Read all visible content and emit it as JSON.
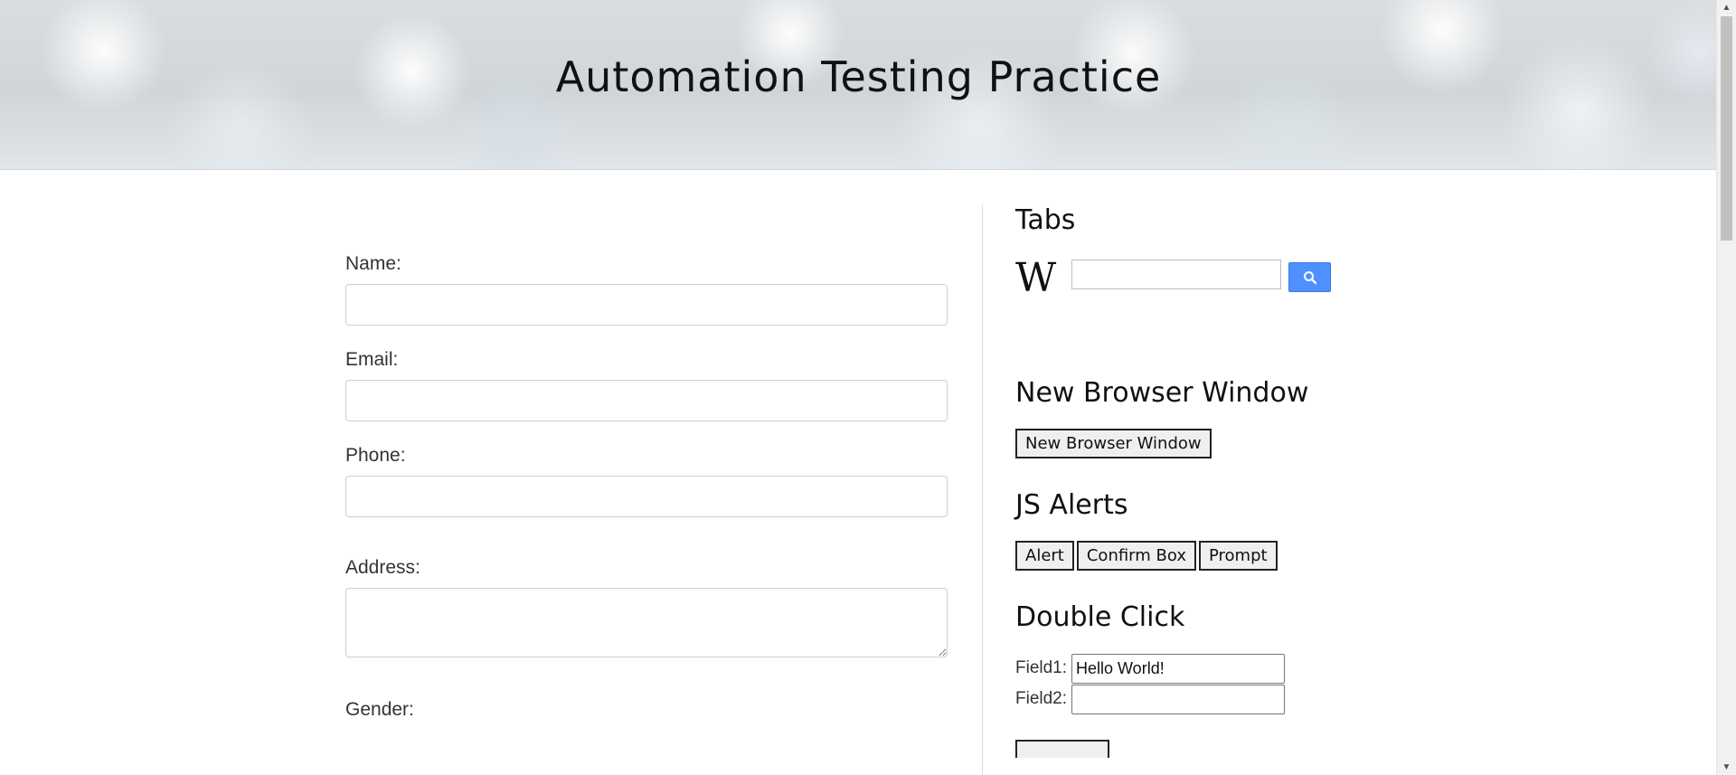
{
  "header": {
    "title": "Automation Testing Practice"
  },
  "form": {
    "name_label": "Name:",
    "email_label": "Email:",
    "phone_label": "Phone:",
    "address_label": "Address:",
    "gender_label": "Gender:",
    "name_value": "",
    "email_value": "",
    "phone_value": "",
    "address_value": ""
  },
  "tabs": {
    "title": "Tabs",
    "wiki_logo": "W",
    "search_value": "",
    "search_icon": "search-icon"
  },
  "new_window": {
    "title": "New Browser Window",
    "button_label": "New Browser Window"
  },
  "alerts": {
    "title": "JS Alerts",
    "alert_label": "Alert",
    "confirm_label": "Confirm Box",
    "prompt_label": "Prompt"
  },
  "double_click": {
    "title": "Double Click",
    "field1_label": "Field1:",
    "field1_value": "Hello World!",
    "field2_label": "Field2:",
    "field2_value": ""
  },
  "colors": {
    "search_button": "#4d90fe",
    "scrollbar_thumb": "#c1c1c1"
  }
}
